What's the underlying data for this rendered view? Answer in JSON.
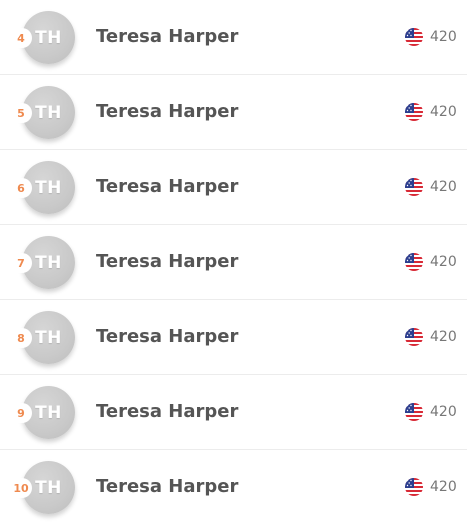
{
  "colors": {
    "rank": "#ef8a4f",
    "name": "#555555",
    "score": "#777777",
    "avatar": "#c9c9c9",
    "divider": "#ececec"
  },
  "rows": [
    {
      "rank": "4",
      "initials": "TH",
      "name": "Teresa Harper",
      "flag_icon": "us-flag-icon",
      "score": "420"
    },
    {
      "rank": "5",
      "initials": "TH",
      "name": "Teresa Harper",
      "flag_icon": "us-flag-icon",
      "score": "420"
    },
    {
      "rank": "6",
      "initials": "TH",
      "name": "Teresa Harper",
      "flag_icon": "us-flag-icon",
      "score": "420"
    },
    {
      "rank": "7",
      "initials": "TH",
      "name": "Teresa Harper",
      "flag_icon": "us-flag-icon",
      "score": "420"
    },
    {
      "rank": "8",
      "initials": "TH",
      "name": "Teresa Harper",
      "flag_icon": "us-flag-icon",
      "score": "420"
    },
    {
      "rank": "9",
      "initials": "TH",
      "name": "Teresa Harper",
      "flag_icon": "us-flag-icon",
      "score": "420"
    },
    {
      "rank": "10",
      "initials": "TH",
      "name": "Teresa Harper",
      "flag_icon": "us-flag-icon",
      "score": "420"
    }
  ]
}
